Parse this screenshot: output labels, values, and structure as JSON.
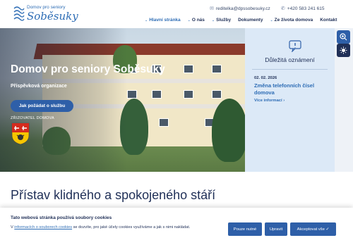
{
  "header": {
    "logo_small": "Domov pro seniory",
    "logo_big": "Soběsuky",
    "email": "reditelka@dpssobesuky.cz",
    "phone": "+420 583 241 615"
  },
  "nav": {
    "items": [
      {
        "label": "Hlavní stránka",
        "has_menu": true
      },
      {
        "label": "O nás",
        "has_menu": true
      },
      {
        "label": "Služby",
        "has_menu": true
      },
      {
        "label": "Dokumenty",
        "has_menu": false
      },
      {
        "label": "Ze života domova",
        "has_menu": true
      },
      {
        "label": "Kontakt",
        "has_menu": false
      }
    ]
  },
  "hero": {
    "title": "Domov pro seniory Soběsuky",
    "subtitle": "Příspěvková organizace",
    "button": "Jak požádat o službu",
    "founder_label": "ZŘIZOVATEL DOMOVA"
  },
  "notice": {
    "title": "Důležitá oznámení",
    "date": "02. 02. 2026",
    "link": "Změna telefonních čísel domova",
    "more": "Více informací ›"
  },
  "section": {
    "title": "Přístav klidného a spokojeného stáří"
  },
  "cookie": {
    "title": "Tato webová stránka používá soubory cookies",
    "text_prefix": "V ",
    "text_link": "informacích o souborech cookies",
    "text_suffix": " se dozvíte, pro jaké účely cookies využíváme a jak s nimi nakládat.",
    "btn_necessary": "Pouze nutné",
    "btn_edit": "Upravit",
    "btn_accept": "Akceptovat vše ✓"
  },
  "colors": {
    "primary": "#2e5fa8",
    "navy": "#1f2f57",
    "notice_bg": "#dce9f7"
  }
}
